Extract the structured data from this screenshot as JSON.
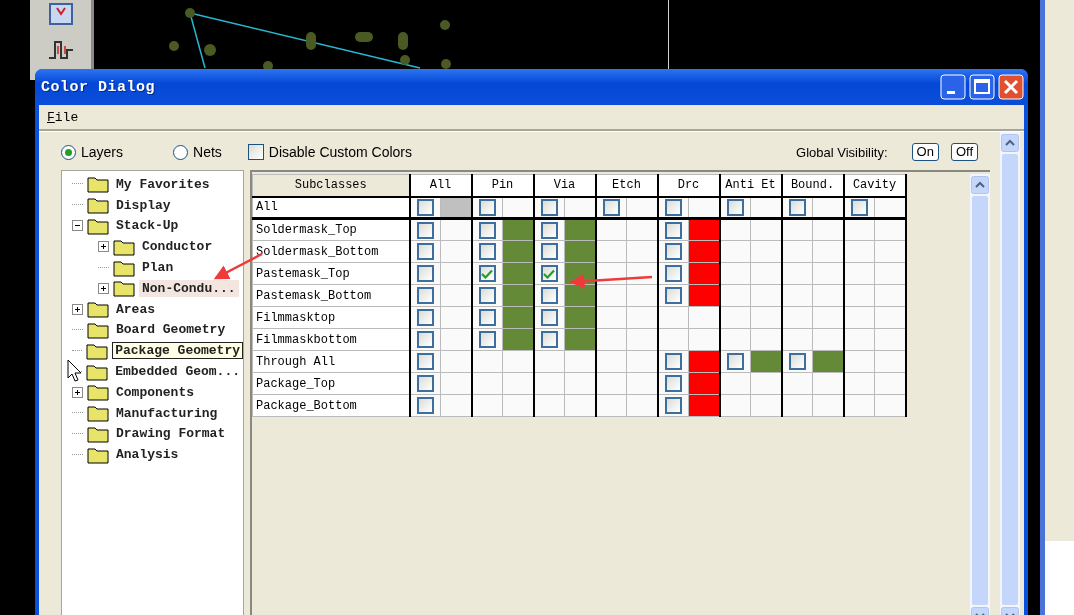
{
  "window": {
    "title": "Color Dialog"
  },
  "menu": [
    "File"
  ],
  "options": {
    "radios": [
      {
        "label": "Layers",
        "selected": true
      },
      {
        "label": "Nets",
        "selected": false
      }
    ],
    "disable_custom_colors": {
      "label": "Disable Custom Colors",
      "checked": false
    },
    "global_visibility": {
      "label": "Global Visibility:",
      "buttons": [
        "On",
        "Off"
      ]
    }
  },
  "tree": [
    {
      "label": "My Favorites",
      "selected": false,
      "hover": false
    },
    {
      "label": "Display",
      "selected": false,
      "hover": false
    },
    {
      "label": "Stack-Up",
      "selected": false,
      "hover": false,
      "expanded": true,
      "children": [
        {
          "label": "Conductor",
          "selected": false,
          "hover": false,
          "expanded": false
        },
        {
          "label": "Plan",
          "selected": false,
          "hover": false
        },
        {
          "label": "Non-Condu...",
          "selected": true,
          "hover": false,
          "expanded": false
        }
      ]
    },
    {
      "label": "Areas",
      "selected": false,
      "hover": false,
      "expanded": false
    },
    {
      "label": "Board Geometry",
      "selected": false,
      "hover": false
    },
    {
      "label": "Package Geometry",
      "selected": false,
      "hover": true
    },
    {
      "label": "Embedded Geom...",
      "selected": false,
      "hover": false
    },
    {
      "label": "Components",
      "selected": false,
      "hover": false,
      "expanded": false
    },
    {
      "label": "Manufacturing",
      "selected": false,
      "hover": false
    },
    {
      "label": "Drawing Format",
      "selected": false,
      "hover": false
    },
    {
      "label": "Analysis",
      "selected": false,
      "hover": false
    }
  ],
  "table": {
    "header": "Subclasses",
    "columns": [
      "All",
      "Pin",
      "Via",
      "Etch",
      "Drc",
      "Anti Et",
      "Bound.",
      "Cavity"
    ],
    "rows": [
      {
        "name": "All",
        "cells": [
          {
            "kind": "check",
            "checked": false,
            "color": "#c0c0c0"
          },
          {
            "kind": "check",
            "checked": false
          },
          {
            "kind": "check",
            "checked": false
          },
          {
            "kind": "check",
            "checked": false
          },
          {
            "kind": "check",
            "checked": false
          },
          {
            "kind": "check",
            "checked": false
          },
          {
            "kind": "check",
            "checked": false
          },
          {
            "kind": "check",
            "checked": false
          }
        ]
      },
      {
        "name": "Soldermask_Top",
        "cells": [
          {
            "kind": "check",
            "checked": false
          },
          {
            "kind": "check",
            "checked": false,
            "color": "#648a37"
          },
          {
            "kind": "check",
            "checked": false,
            "color": "#648a37"
          },
          {
            "kind": "empty"
          },
          {
            "kind": "check",
            "checked": false,
            "color": "#ff0000"
          },
          {
            "kind": "empty"
          },
          {
            "kind": "empty"
          },
          {
            "kind": "empty"
          }
        ]
      },
      {
        "name": "Soldermask_Bottom",
        "cells": [
          {
            "kind": "check",
            "checked": false
          },
          {
            "kind": "check",
            "checked": false,
            "color": "#648a37"
          },
          {
            "kind": "check",
            "checked": false,
            "color": "#648a37"
          },
          {
            "kind": "empty"
          },
          {
            "kind": "check",
            "checked": false,
            "color": "#ff0000"
          },
          {
            "kind": "empty"
          },
          {
            "kind": "empty"
          },
          {
            "kind": "empty"
          }
        ]
      },
      {
        "name": "Pastemask_Top",
        "cells": [
          {
            "kind": "check",
            "checked": false
          },
          {
            "kind": "check",
            "checked": true,
            "color": "#648a37"
          },
          {
            "kind": "check",
            "checked": true,
            "color": "#648a37"
          },
          {
            "kind": "empty"
          },
          {
            "kind": "check",
            "checked": false,
            "color": "#ff0000"
          },
          {
            "kind": "empty"
          },
          {
            "kind": "empty"
          },
          {
            "kind": "empty"
          }
        ]
      },
      {
        "name": "Pastemask_Bottom",
        "cells": [
          {
            "kind": "check",
            "checked": false
          },
          {
            "kind": "check",
            "checked": false,
            "color": "#648a37"
          },
          {
            "kind": "check",
            "checked": false,
            "color": "#648a37"
          },
          {
            "kind": "empty"
          },
          {
            "kind": "check",
            "checked": false,
            "color": "#ff0000"
          },
          {
            "kind": "empty"
          },
          {
            "kind": "empty"
          },
          {
            "kind": "empty"
          }
        ]
      },
      {
        "name": "Filmmasktop",
        "cells": [
          {
            "kind": "check",
            "checked": false
          },
          {
            "kind": "check",
            "checked": false,
            "color": "#648a37"
          },
          {
            "kind": "check",
            "checked": false,
            "color": "#648a37"
          },
          {
            "kind": "empty"
          },
          {
            "kind": "empty"
          },
          {
            "kind": "empty"
          },
          {
            "kind": "empty"
          },
          {
            "kind": "empty"
          }
        ]
      },
      {
        "name": "Filmmaskbottom",
        "cells": [
          {
            "kind": "check",
            "checked": false
          },
          {
            "kind": "check",
            "checked": false,
            "color": "#648a37"
          },
          {
            "kind": "check",
            "checked": false,
            "color": "#648a37"
          },
          {
            "kind": "empty"
          },
          {
            "kind": "empty"
          },
          {
            "kind": "empty"
          },
          {
            "kind": "empty"
          },
          {
            "kind": "empty"
          }
        ]
      },
      {
        "name": "Through All",
        "cells": [
          {
            "kind": "check",
            "checked": false
          },
          {
            "kind": "empty"
          },
          {
            "kind": "empty"
          },
          {
            "kind": "empty"
          },
          {
            "kind": "check",
            "checked": false,
            "color": "#ff0000"
          },
          {
            "kind": "check",
            "checked": false,
            "color": "#648a37"
          },
          {
            "kind": "check",
            "checked": false,
            "color": "#648a37"
          },
          {
            "kind": "empty"
          }
        ]
      },
      {
        "name": "Package_Top",
        "cells": [
          {
            "kind": "check",
            "checked": false
          },
          {
            "kind": "empty"
          },
          {
            "kind": "empty"
          },
          {
            "kind": "empty"
          },
          {
            "kind": "check",
            "checked": false,
            "color": "#ff0000"
          },
          {
            "kind": "empty"
          },
          {
            "kind": "empty"
          },
          {
            "kind": "empty"
          }
        ]
      },
      {
        "name": "Package_Bottom",
        "cells": [
          {
            "kind": "check",
            "checked": false
          },
          {
            "kind": "empty"
          },
          {
            "kind": "empty"
          },
          {
            "kind": "empty"
          },
          {
            "kind": "check",
            "checked": false,
            "color": "#ff0000"
          },
          {
            "kind": "empty"
          },
          {
            "kind": "empty"
          },
          {
            "kind": "empty"
          }
        ]
      }
    ]
  }
}
